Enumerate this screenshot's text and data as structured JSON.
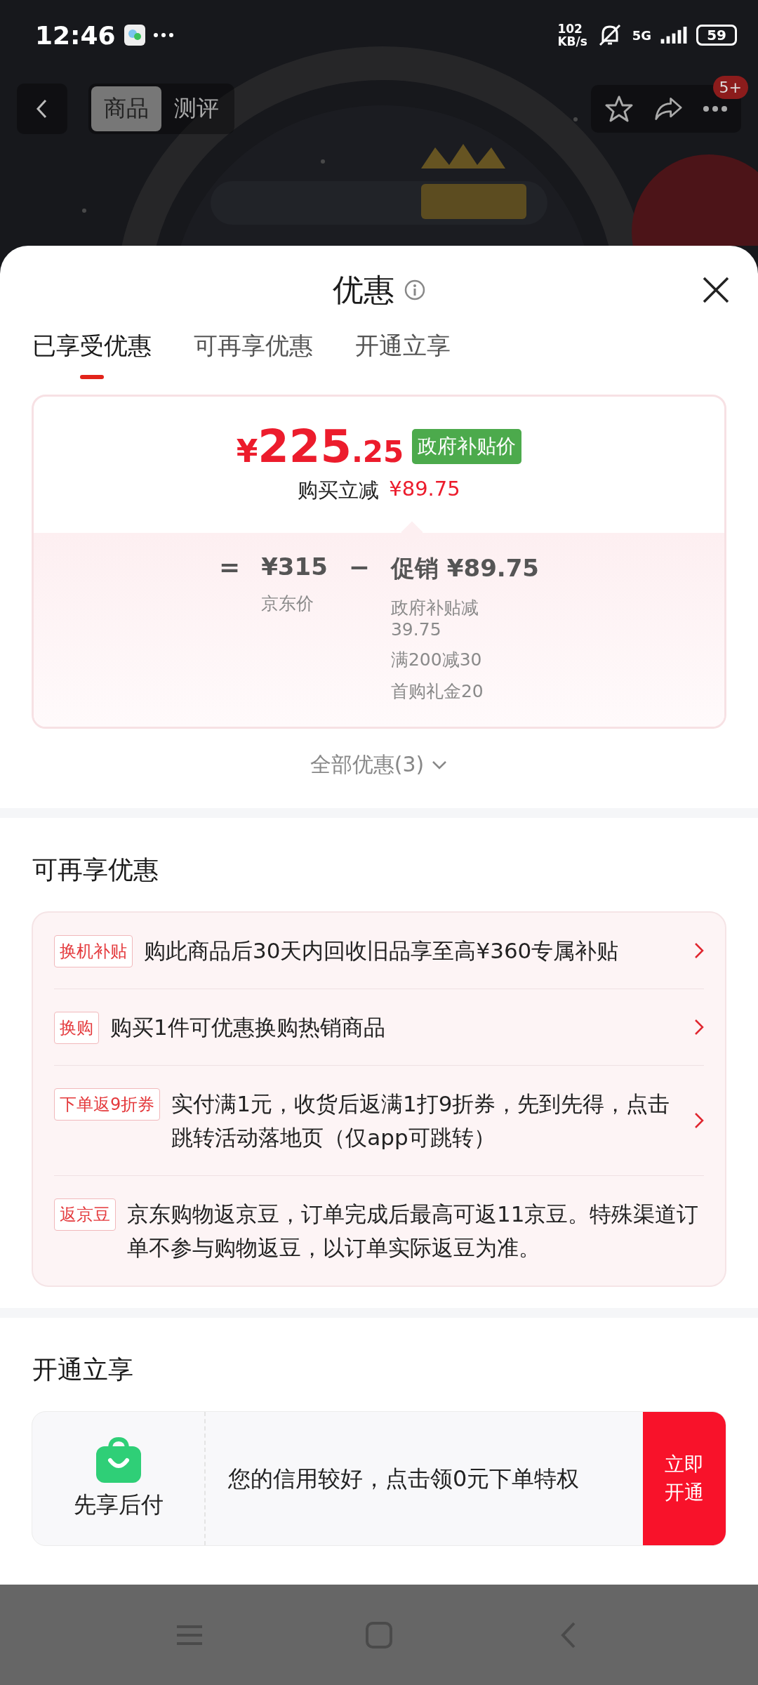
{
  "status_bar": {
    "time": "12:46",
    "speed_value": "102",
    "speed_unit": "KB/s",
    "network": "5G",
    "battery": "59"
  },
  "nav": {
    "tabs": [
      {
        "label": "商品",
        "selected": true
      },
      {
        "label": "测评",
        "selected": false
      }
    ],
    "badge": "5+"
  },
  "sheet": {
    "title": "优惠",
    "tabs": [
      {
        "label": "已享受优惠",
        "selected": true
      },
      {
        "label": "可再享优惠",
        "selected": false
      },
      {
        "label": "开通立享",
        "selected": false
      }
    ],
    "price_card": {
      "currency": "¥",
      "price_int": "225",
      "price_dec": ".25",
      "tag": "政府补贴价",
      "saving_label": "购买立减",
      "saving": "¥89.75",
      "equals": "=",
      "base_price": "¥315",
      "base_label": "京东价",
      "minus": "−",
      "promo_label": "促销",
      "promo_amount": "¥89.75",
      "promo_items": [
        "政府补贴减39.75",
        "满200减30",
        "首购礼金20"
      ]
    },
    "all_offers": "全部优惠(3)",
    "more_section": {
      "title": "可再享优惠",
      "items": [
        {
          "tag": "换机补贴",
          "text": "购此商品后30天内回收旧品享至高¥360专属补贴",
          "arrow": true
        },
        {
          "tag": "换购",
          "text": "购买1件可优惠换购热销商品",
          "arrow": true
        },
        {
          "tag": "下单返9折券",
          "text": "实付满1元，收货后返满1打9折券，先到先得，点击跳转活动落地页（仅app可跳转）",
          "arrow": true
        },
        {
          "tag": "返京豆",
          "text": "京东购物返京豆，订单完成后最高可返11京豆。特殊渠道订单不参与购物返豆，以订单实际返豆为准。",
          "arrow": false
        }
      ]
    },
    "open_section": {
      "title": "开通立享",
      "service": {
        "name": "先享后付",
        "text": "您的信用较好，点击领0元下单特权",
        "button": "立即开通"
      }
    }
  }
}
